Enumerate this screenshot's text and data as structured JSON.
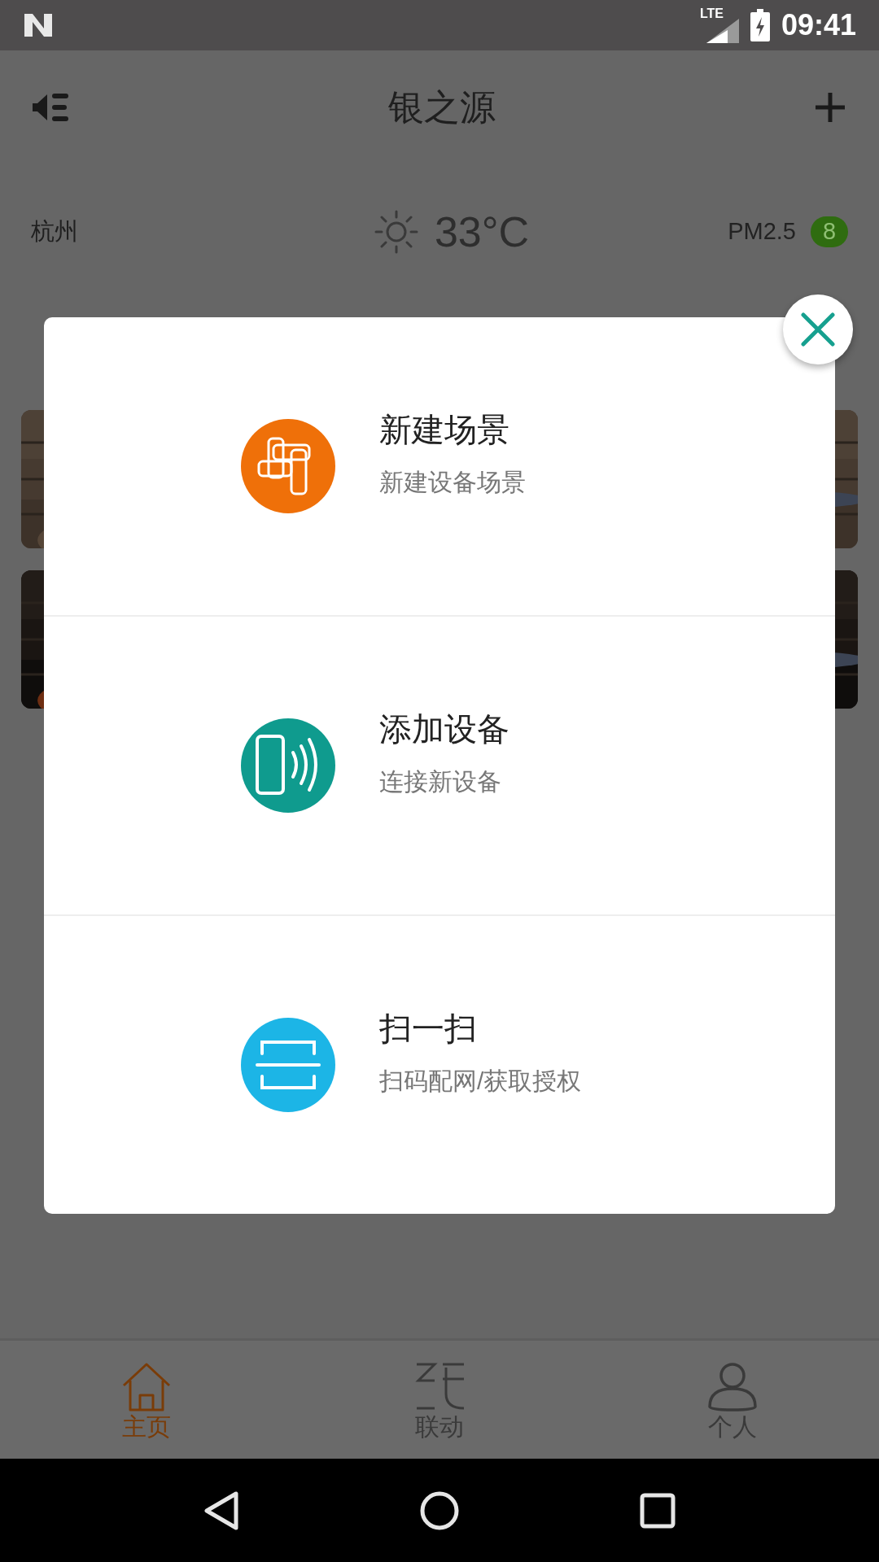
{
  "status_bar": {
    "network": "LTE",
    "time": "09:41"
  },
  "header": {
    "title": "银之源"
  },
  "weather": {
    "city": "杭州",
    "temperature": "33°C",
    "pm_label": "PM2.5",
    "pm_value": "8"
  },
  "menu": {
    "items": [
      {
        "kind": "scene",
        "title": "新建场景",
        "subtitle": "新建设备场景",
        "color": "#ef7009"
      },
      {
        "kind": "device",
        "title": "添加设备",
        "subtitle": "连接新设备",
        "color": "#0f9b8e"
      },
      {
        "kind": "scan",
        "title": "扫一扫",
        "subtitle": "扫码配网/获取授权",
        "color": "#1cb5e6"
      }
    ]
  },
  "nav": [
    {
      "kind": "home",
      "label": "主页",
      "selected": true
    },
    {
      "kind": "link",
      "label": "联动",
      "selected": false
    },
    {
      "kind": "person",
      "label": "个人",
      "selected": false
    }
  ]
}
